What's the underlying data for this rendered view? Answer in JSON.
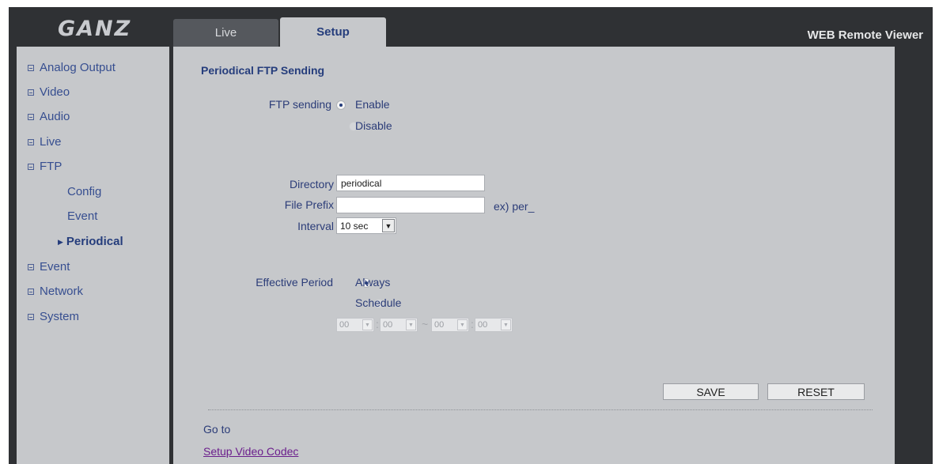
{
  "header": {
    "logo_text": "GANZ",
    "app_title": "WEB Remote Viewer",
    "tabs": [
      {
        "label": "Live",
        "active": false
      },
      {
        "label": "Setup",
        "active": true
      }
    ]
  },
  "sidebar": {
    "items": [
      {
        "label": "Analog Output"
      },
      {
        "label": "Video"
      },
      {
        "label": "Audio"
      },
      {
        "label": "Live"
      },
      {
        "label": "FTP"
      }
    ],
    "ftp_sub": [
      {
        "label": "Config"
      },
      {
        "label": "Event"
      },
      {
        "label": "Periodical",
        "active": true
      }
    ],
    "items_after": [
      {
        "label": "Event"
      },
      {
        "label": "Network"
      },
      {
        "label": "System"
      }
    ]
  },
  "main": {
    "section_title": "Periodical FTP Sending",
    "ftp_sending": {
      "label": "FTP sending",
      "options": [
        "Enable",
        "Disable"
      ],
      "selected": "Enable"
    },
    "directory": {
      "label": "Directory",
      "value": "periodical"
    },
    "file_prefix": {
      "label": "File Prefix",
      "value": "",
      "hint": "ex) per_"
    },
    "interval": {
      "label": "Interval",
      "value": "10 sec"
    },
    "effective_period": {
      "label": "Effective Period",
      "options": [
        "Always",
        "Schedule"
      ],
      "selected": "Always",
      "schedule": {
        "start_hour": "00",
        "start_min": "00",
        "end_hour": "00",
        "end_min": "00",
        "colon": ":",
        "dash": "~"
      }
    },
    "buttons": {
      "save": "SAVE",
      "reset": "RESET"
    },
    "go_to": {
      "label": "Go to",
      "link": "Setup Video Codec"
    }
  },
  "colors": {
    "app_bg": "#2f3134",
    "panel_bg": "#c6c8cb",
    "active_tab_text": "#253d7c",
    "link": "#6b1e8c"
  }
}
